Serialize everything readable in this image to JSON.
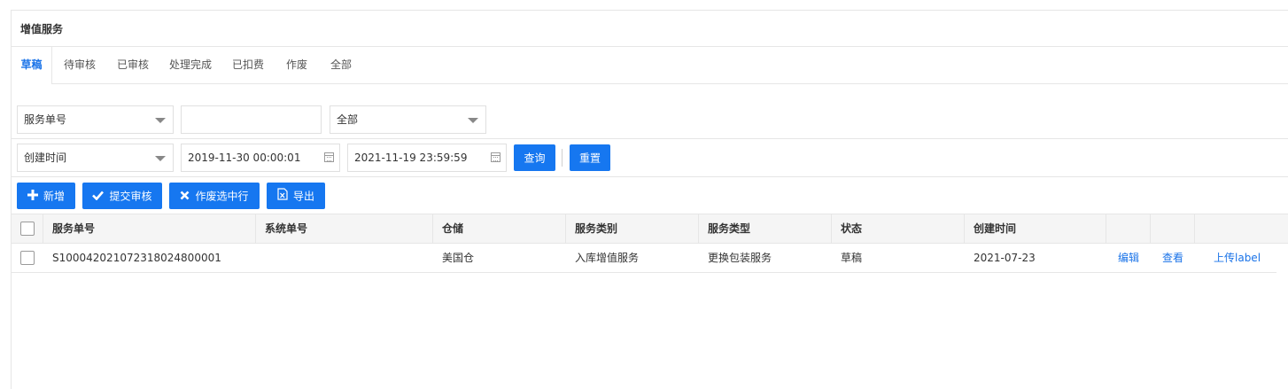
{
  "panel": {
    "title": "增值服务"
  },
  "tabs": [
    {
      "label": "草稿"
    },
    {
      "label": "待审核"
    },
    {
      "label": "已审核"
    },
    {
      "label": "处理完成"
    },
    {
      "label": "已扣费"
    },
    {
      "label": "作废"
    },
    {
      "label": "全部"
    }
  ],
  "filters": {
    "field_select": "服务单号",
    "keyword_value": "",
    "warehouse_select": "全部",
    "time_select": "创建时间",
    "start_time": "2019-11-30 00:00:01",
    "end_time": "2021-11-19 23:59:59",
    "query_label": "查询",
    "reset_label": "重置"
  },
  "toolbar": {
    "add_label": "新增",
    "submit_label": "提交审核",
    "void_label": "作废选中行",
    "export_label": "导出"
  },
  "table": {
    "headers": [
      "服务单号",
      "系统单号",
      "仓储",
      "服务类别",
      "服务类型",
      "状态",
      "创建时间"
    ],
    "rows": [
      {
        "service_no": "S100042021072318024800001",
        "system_no": "",
        "warehouse": "美国仓",
        "category": "入库增值服务",
        "type": "更换包装服务",
        "status": "草稿",
        "created": "2021-07-23",
        "edit": "编辑",
        "view": "查看",
        "upload": "上传label"
      }
    ]
  },
  "colors": {
    "primary": "#1677f0",
    "link": "#1a73e8"
  }
}
